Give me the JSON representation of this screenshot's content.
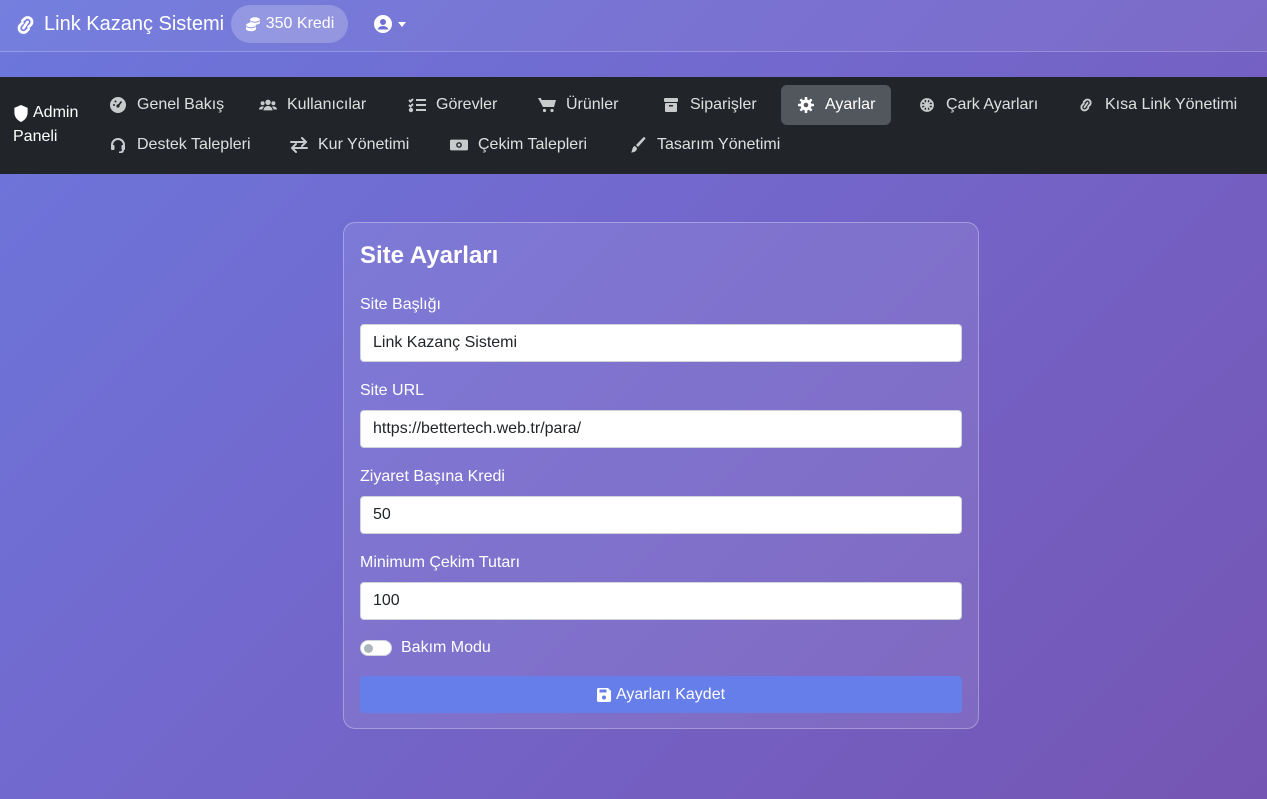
{
  "topbar": {
    "brand": "Link Kazanç Sistemi",
    "credits": "350 Kredi"
  },
  "admin_nav": {
    "brand_line1": "Admin",
    "brand_line2": "Paneli",
    "items": [
      {
        "label": "Genel Bakış",
        "icon": "gauge-icon"
      },
      {
        "label": "Kullanıcılar",
        "icon": "users-icon"
      },
      {
        "label": "Görevler",
        "icon": "tasks-icon"
      },
      {
        "label": "Ürünler",
        "icon": "cart-icon"
      },
      {
        "label": "Siparişler",
        "icon": "box-icon"
      },
      {
        "label": "Ayarlar",
        "icon": "gear-icon",
        "active": true
      },
      {
        "label": "Çark Ayarları",
        "icon": "wheel-icon"
      },
      {
        "label": "Kısa Link Yönetimi",
        "icon": "link-icon"
      },
      {
        "label": "Destek Talepleri",
        "icon": "headset-icon"
      },
      {
        "label": "Kur Yönetimi",
        "icon": "exchange-icon"
      },
      {
        "label": "Çekim Talepleri",
        "icon": "money-icon"
      },
      {
        "label": "Tasarım Yönetimi",
        "icon": "brush-icon"
      }
    ]
  },
  "settings": {
    "title": "Site Ayarları",
    "fields": [
      {
        "label": "Site Başlığı",
        "value": "Link Kazanç Sistemi"
      },
      {
        "label": "Site URL",
        "value": "https://bettertech.web.tr/para/"
      },
      {
        "label": "Ziyaret Başına Kredi",
        "value": "50"
      },
      {
        "label": "Minimum Çekim Tutarı",
        "value": "100"
      }
    ],
    "maintenance_label": "Bakım Modu",
    "maintenance_on": false,
    "save_label": "Ayarları Kaydet"
  },
  "colors": {
    "accent": "#667eea",
    "nav_bg": "#212529",
    "active_bg": "#52575d"
  }
}
